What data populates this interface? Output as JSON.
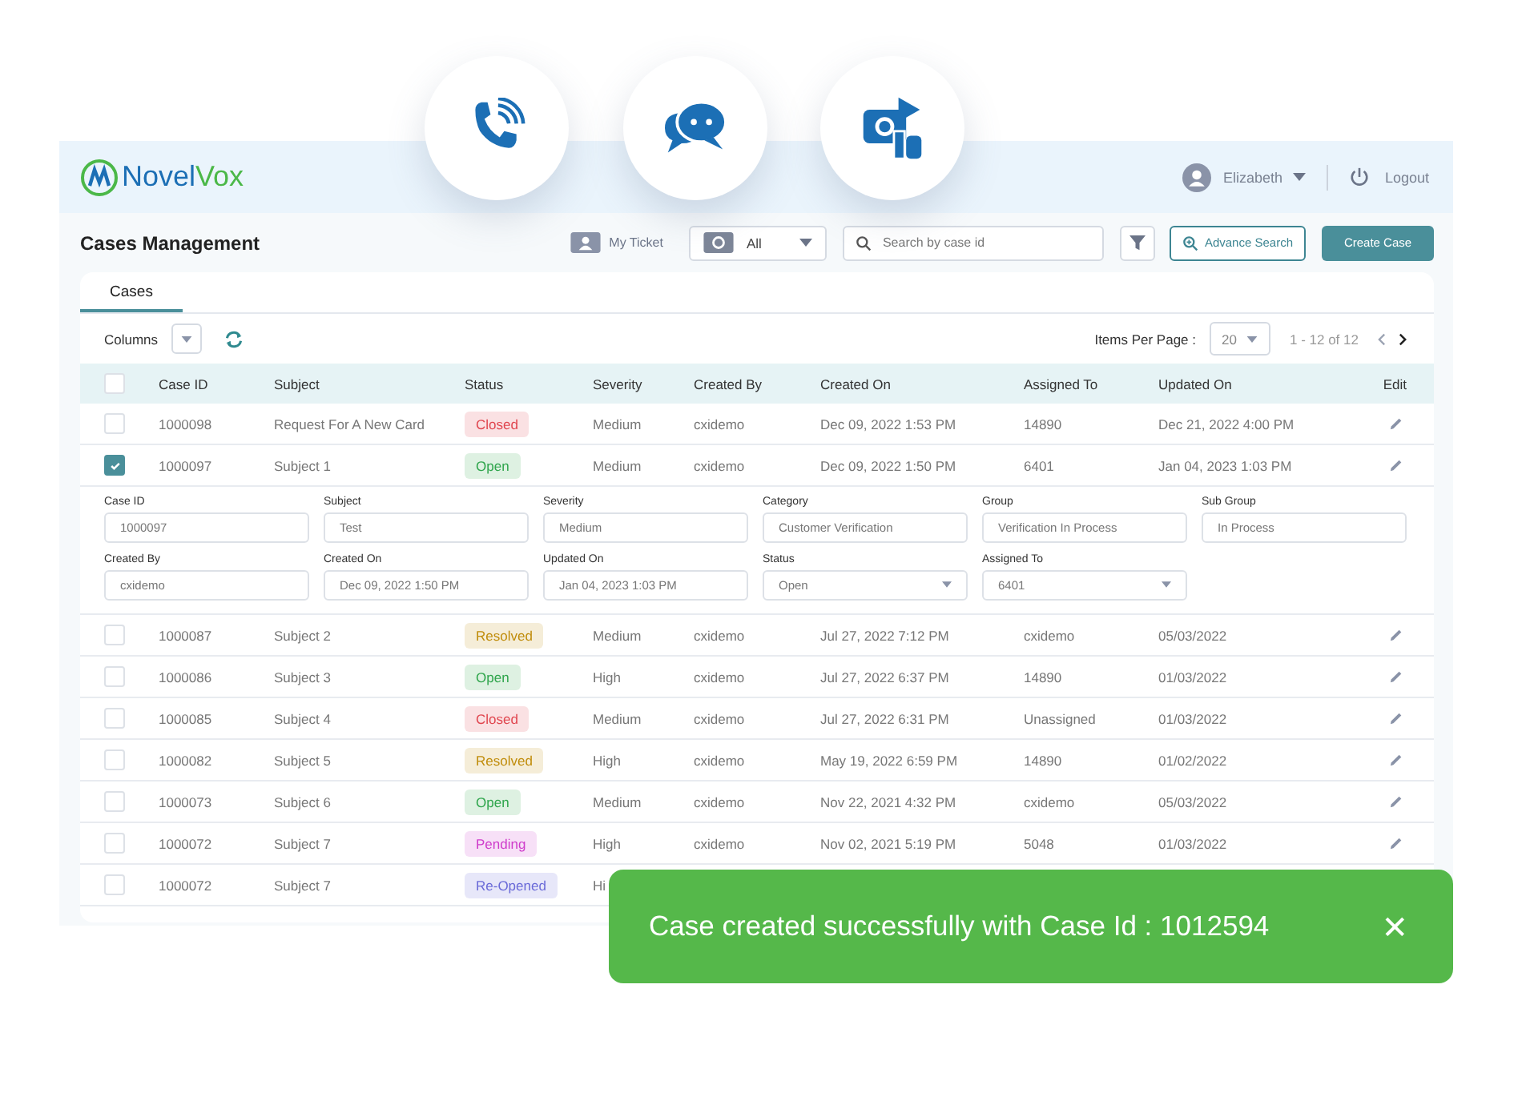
{
  "header": {
    "brand_start": "Novel",
    "brand_end": "Vox",
    "user": "Elizabeth",
    "logout": "Logout"
  },
  "toolbar": {
    "title": "Cases Management",
    "my_ticket": "My Ticket",
    "view": "All",
    "search": {
      "placeholder": "Search by case id"
    },
    "advance_search": "Advance Search",
    "create": "Create Case"
  },
  "tabs": [
    {
      "label": "Cases",
      "selected": true
    }
  ],
  "controls": {
    "columns": "Columns",
    "items_per_page_label": "Items Per Page :",
    "items_per_page": "20",
    "range": "1 - 12 of 12"
  },
  "table": {
    "select_all": {
      "checked": false
    },
    "columns": [
      "Case ID",
      "Subject",
      "Status",
      "Severity",
      "Created By",
      "Created On",
      "Assigned To",
      "Updated On",
      "Edit"
    ],
    "rows": [
      {
        "checked": false,
        "case_id": "1000098",
        "subject": "Request For A New Card",
        "status": {
          "label": "Closed",
          "color": "#e0464f"
        },
        "severity": "Medium",
        "created_by": "cxidemo",
        "created_on": "Dec 09, 2022 1:53 PM",
        "assigned_to": "14890",
        "updated_on": "Dec 21, 2022 4:00 PM"
      },
      {
        "checked": true,
        "case_id": "1000097",
        "subject": "Subject 1",
        "status": {
          "label": "Open",
          "color": "#2fa54c"
        },
        "severity": "Medium",
        "created_by": "cxidemo",
        "created_on": "Dec 09, 2022 1:50 PM",
        "assigned_to": "6401",
        "updated_on": "Jan 04, 2023 1:03 PM",
        "details": [
          {
            "label": "Case ID",
            "value": "1000097",
            "kind": "text"
          },
          {
            "label": "Subject",
            "value": "Test",
            "kind": "text"
          },
          {
            "label": "Severity",
            "value": "Medium",
            "kind": "text"
          },
          {
            "label": "Category",
            "value": "Customer Verification",
            "kind": "text"
          },
          {
            "label": "Group",
            "value": "Verification In Process",
            "kind": "text"
          },
          {
            "label": "Sub Group",
            "value": "In Process",
            "kind": "text"
          },
          {
            "label": "Created By",
            "value": "cxidemo",
            "kind": "text"
          },
          {
            "label": "Created On",
            "value": "Dec 09, 2022 1:50 PM",
            "kind": "text"
          },
          {
            "label": "Updated On",
            "value": "Jan 04, 2023 1:03 PM",
            "kind": "text"
          },
          {
            "label": "Status",
            "value": "Open",
            "kind": "select"
          },
          {
            "label": "Assigned To",
            "value": "6401",
            "kind": "select"
          }
        ]
      },
      {
        "checked": false,
        "case_id": "1000087",
        "subject": "Subject 2",
        "status": {
          "label": "Resolved",
          "color": "#c08c0a"
        },
        "severity": "Medium",
        "created_by": "cxidemo",
        "created_on": "Jul 27, 2022 7:12 PM",
        "assigned_to": "cxidemo",
        "updated_on": "05/03/2022"
      },
      {
        "checked": false,
        "case_id": "1000086",
        "subject": "Subject 3",
        "status": {
          "label": "Open",
          "color": "#2fa54c"
        },
        "severity": "High",
        "created_by": "cxidemo",
        "created_on": "Jul 27, 2022 6:37 PM",
        "assigned_to": "14890",
        "updated_on": "01/03/2022"
      },
      {
        "checked": false,
        "case_id": "1000085",
        "subject": "Subject 4",
        "status": {
          "label": "Closed",
          "color": "#e0464f"
        },
        "severity": "Medium",
        "created_by": "cxidemo",
        "created_on": "Jul 27, 2022 6:31 PM",
        "assigned_to": "Unassigned",
        "updated_on": "01/03/2022"
      },
      {
        "checked": false,
        "case_id": "1000082",
        "subject": "Subject 5",
        "status": {
          "label": "Resolved",
          "color": "#c08c0a"
        },
        "severity": "High",
        "created_by": "cxidemo",
        "created_on": "May 19, 2022 6:59 PM",
        "assigned_to": "14890",
        "updated_on": "01/02/2022"
      },
      {
        "checked": false,
        "case_id": "1000073",
        "subject": "Subject 6",
        "status": {
          "label": "Open",
          "color": "#2fa54c"
        },
        "severity": "Medium",
        "created_by": "cxidemo",
        "created_on": "Nov 22, 2021 4:32 PM",
        "assigned_to": "cxidemo",
        "updated_on": "05/03/2022"
      },
      {
        "checked": false,
        "case_id": "1000072",
        "subject": "Subject 7",
        "status": {
          "label": "Pending",
          "color": "#cf3ccb"
        },
        "severity": "High",
        "created_by": "cxidemo",
        "created_on": "Nov 02, 2021 5:19 PM",
        "assigned_to": "5048",
        "updated_on": "01/03/2022"
      },
      {
        "checked": false,
        "case_id": "1000072",
        "subject": "Subject 7",
        "status": {
          "label": "Re-Opened",
          "color": "#6a6ad8"
        },
        "severity": "Hi"
      }
    ]
  },
  "toast": {
    "message": "Case created successfully with Case Id : 1012594",
    "close": "✕"
  }
}
